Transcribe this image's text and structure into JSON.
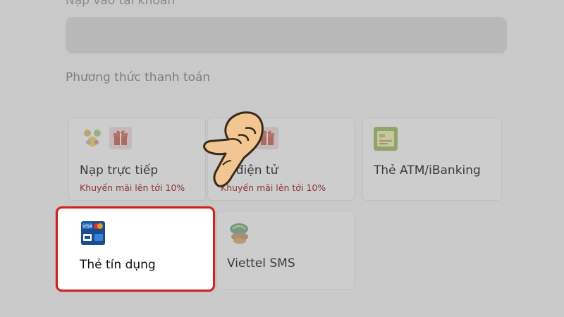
{
  "header": {
    "amount_label": "Nạp vào tài khoản"
  },
  "payment": {
    "section_title": "Phương thức thanh toán",
    "methods": [
      {
        "label": "Nạp trực tiếp",
        "promo": "Khuyến mãi lên tới 10%"
      },
      {
        "label": "Ví điện tử",
        "promo": "Khuyến mãi lên tới 10%"
      },
      {
        "label": "Thẻ ATM/iBanking",
        "promo": ""
      },
      {
        "label": "Thẻ tín dụng",
        "promo": "",
        "selected": true
      },
      {
        "label": "Viettel SMS",
        "promo": ""
      }
    ]
  },
  "colors": {
    "highlight": "#d21f1f",
    "promo": "#8a3535",
    "overlay": "#c9c9c9"
  },
  "icons": [
    "recharge-icon",
    "gift-icon",
    "wallet-icon",
    "atm-card-icon",
    "credit-card-icon",
    "viettel-icon",
    "pointing-hand-icon"
  ]
}
